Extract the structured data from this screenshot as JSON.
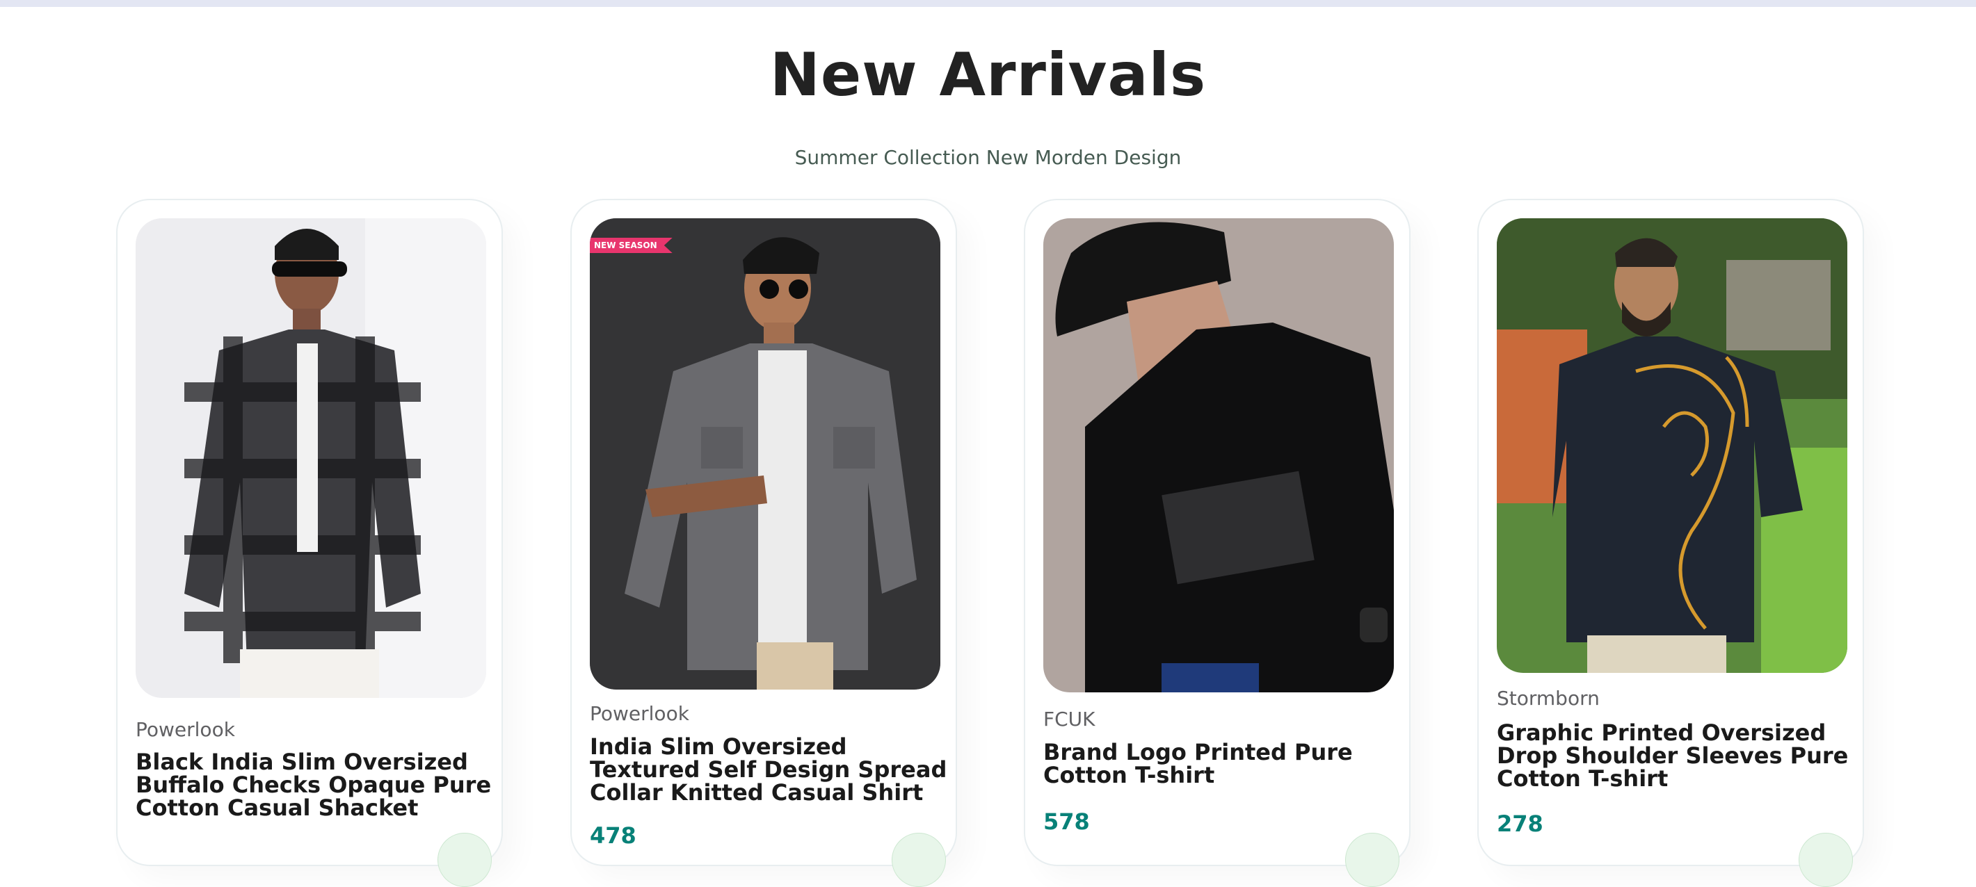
{
  "section": {
    "title": "New Arrivals",
    "subtitle": "Summer Collection New Morden Design"
  },
  "products": [
    {
      "brand": "Powerlook",
      "name": "Black India Slim Oversized Buffalo Checks Opaque Pure Cotton Casual Shacket",
      "price": "",
      "image": "man-checked-shacket-photo"
    },
    {
      "brand": "Powerlook",
      "name": "India Slim Oversized Textured Self Design Spread Collar Knitted Casual Shirt",
      "price": "478",
      "badge": "NEW SEASON",
      "image": "man-grey-textured-shirt-photo"
    },
    {
      "brand": "FCUK",
      "name": "Brand Logo Printed Pure Cotton T-shirt",
      "price": "578",
      "image": "man-black-logo-tshirt-photo"
    },
    {
      "brand": "Stormborn",
      "name": "Graphic Printed Oversized Drop Shoulder Sleeves Pure Cotton T-shirt",
      "price": "278",
      "image": "man-graphic-print-tshirt-photo"
    }
  ],
  "colors": {
    "accent": "#088178",
    "title": "#222222",
    "badge": "#e8356d",
    "cart_button_bg": "#e8f6ea"
  },
  "icons": [
    "cart-icon"
  ]
}
